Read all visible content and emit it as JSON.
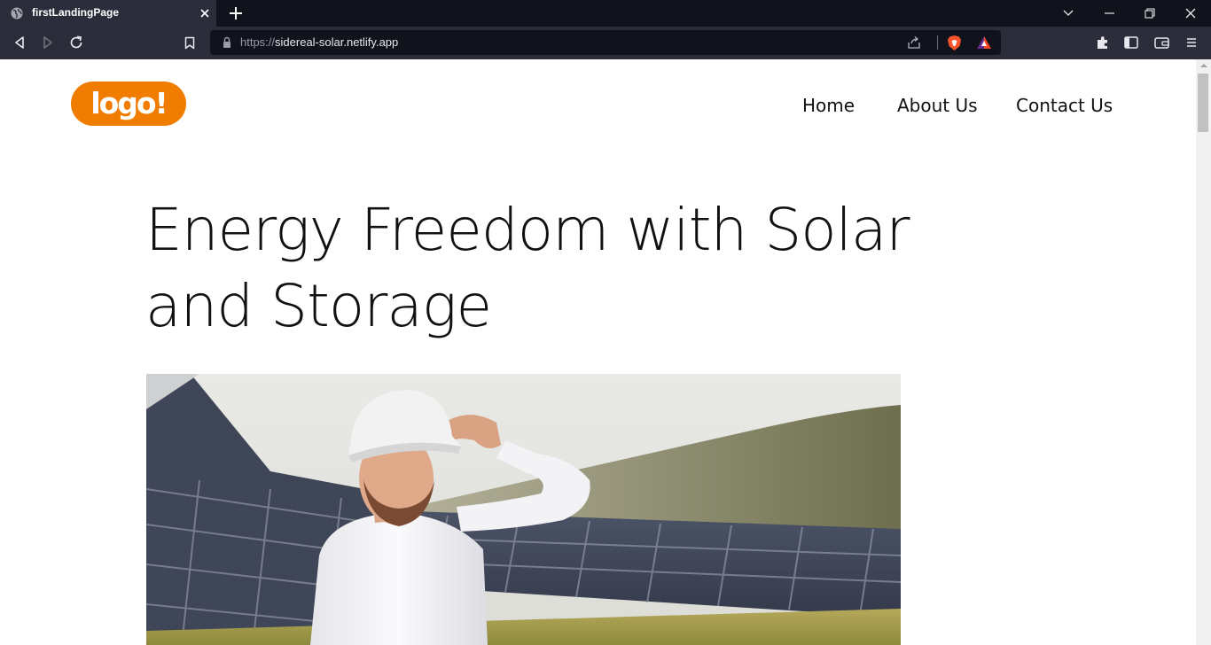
{
  "browser": {
    "tab": {
      "title": "firstLandingPage"
    },
    "url": {
      "scheme": "https://",
      "host": "sidereal-solar.netlify.app"
    }
  },
  "page": {
    "logo": {
      "text": "logo!",
      "color": "#f07c00"
    },
    "nav": [
      {
        "label": "Home"
      },
      {
        "label": "About Us"
      },
      {
        "label": "Contact Us"
      }
    ],
    "hero": {
      "title": "Energy Freedom with Solar and Storage"
    }
  },
  "colors": {
    "chrome_dark": "#10121c",
    "chrome_toolbar": "#2b2d3b",
    "logo_orange": "#f07c00",
    "text": "#111111"
  }
}
